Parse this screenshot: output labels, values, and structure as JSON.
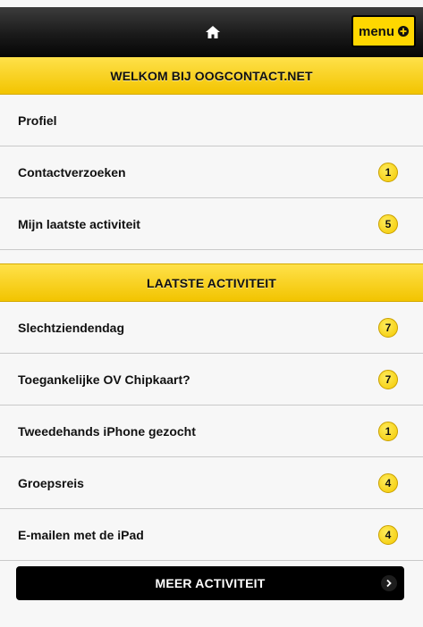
{
  "header": {
    "home_icon": "home-icon",
    "menu_label": "menu",
    "menu_icon": "plus-circle-icon"
  },
  "welcome": {
    "title": "WELKOM BIJ OOGCONTACT.NET",
    "items": [
      {
        "label": "Profiel",
        "badge": ""
      },
      {
        "label": "Contactverzoeken",
        "badge": "1"
      },
      {
        "label": "Mijn laatste activiteit",
        "badge": "5"
      }
    ]
  },
  "activity": {
    "title": "LAATSTE ACTIVITEIT",
    "items": [
      {
        "label": "Slechtziendendag",
        "badge": "7"
      },
      {
        "label": "Toegankelijke OV Chipkaart?",
        "badge": "7"
      },
      {
        "label": "Tweedehands iPhone gezocht",
        "badge": "1"
      },
      {
        "label": "Groepsreis",
        "badge": "4"
      },
      {
        "label": "E-mailen met de iPad",
        "badge": "4"
      }
    ]
  },
  "more": {
    "label": "MEER ACTIVITEIT",
    "icon": "chevron-right-icon"
  },
  "colors": {
    "accent": "#ffd700",
    "bar": "#111111"
  }
}
